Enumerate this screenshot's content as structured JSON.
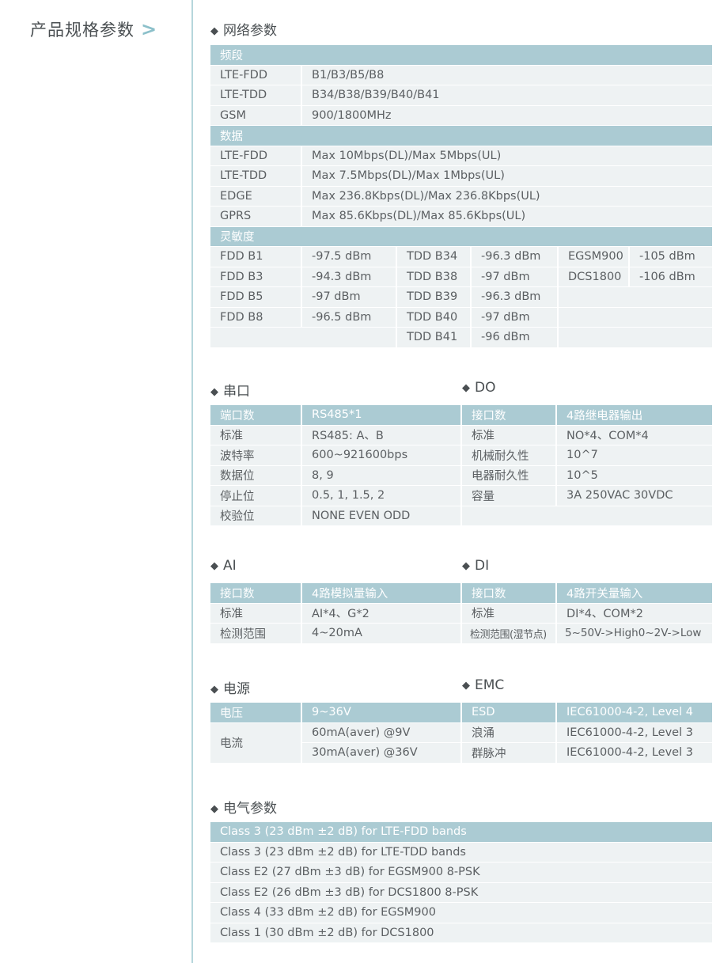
{
  "sidebar": {
    "title": "产品规格参数",
    "chevron": ">"
  },
  "network": {
    "title": "网络参数",
    "band_header": "频段",
    "bands": [
      {
        "name": "LTE-FDD",
        "value": "B1/B3/B5/B8"
      },
      {
        "name": "LTE-TDD",
        "value": "B34/B38/B39/B40/B41"
      },
      {
        "name": "GSM",
        "value": "900/1800MHz"
      }
    ],
    "data_header": "数据",
    "data": [
      {
        "name": "LTE-FDD",
        "value": "Max 10Mbps(DL)/Max 5Mbps(UL)"
      },
      {
        "name": "LTE-TDD",
        "value": "Max 7.5Mbps(DL)/Max 1Mbps(UL)"
      },
      {
        "name": "EDGE",
        "value": "Max 236.8Kbps(DL)/Max 236.8Kbps(UL)"
      },
      {
        "name": "GPRS",
        "value": "Max 85.6Kbps(DL)/Max 85.6Kbps(UL)"
      }
    ],
    "sens_header": "灵敏度",
    "sensitivity": [
      [
        "FDD B1",
        "-97.5 dBm",
        "TDD B34",
        "-96.3 dBm",
        "EGSM900",
        "-105 dBm"
      ],
      [
        "FDD B3",
        "-94.3 dBm",
        "TDD B38",
        "-97 dBm",
        "DCS1800",
        "-106 dBm"
      ],
      [
        "FDD B5",
        "-97 dBm",
        "TDD B39",
        "-96.3 dBm",
        "",
        ""
      ],
      [
        "FDD B8",
        "-96.5 dBm",
        "TDD B40",
        "-97 dBm",
        "",
        ""
      ],
      [
        "",
        "",
        "TDD B41",
        "-96 dBm",
        "",
        ""
      ]
    ]
  },
  "serial": {
    "title": "串口",
    "header": [
      "端口数",
      "RS485*1"
    ],
    "rows": [
      [
        "标准",
        "RS485: A、B"
      ],
      [
        "波特率",
        "600~921600bps"
      ],
      [
        "数据位",
        "8, 9"
      ],
      [
        "停止位",
        "0.5, 1, 1.5, 2"
      ],
      [
        "校验位",
        "NONE EVEN ODD"
      ]
    ]
  },
  "do": {
    "title": "DO",
    "header": [
      "接口数",
      "4路继电器输出"
    ],
    "rows": [
      [
        "标准",
        "NO*4、COM*4"
      ],
      [
        "机械耐久性",
        "10^7"
      ],
      [
        "电器耐久性",
        "10^5"
      ],
      [
        "容量",
        "3A  250VAC 30VDC"
      ]
    ]
  },
  "ai": {
    "title": "AI",
    "header": [
      "接口数",
      "4路模拟量输入"
    ],
    "rows": [
      [
        "标准",
        "AI*4、G*2"
      ],
      [
        "检测范围",
        "4~20mA"
      ]
    ]
  },
  "di": {
    "title": "DI",
    "header": [
      "接口数",
      "4路开关量输入"
    ],
    "rows": [
      [
        "标准",
        "DI*4、COM*2"
      ],
      [
        "检测范围(湿节点)",
        "5~50V->High0~2V->Low"
      ]
    ]
  },
  "power": {
    "title": "电源",
    "header": [
      "电压",
      "9~36V"
    ],
    "current_label": "电流",
    "current_values": [
      "60mA(aver) @9V",
      "30mA(aver) @36V"
    ]
  },
  "emc": {
    "title": "EMC",
    "header": [
      "ESD",
      "IEC61000-4-2, Level 4"
    ],
    "rows": [
      [
        "浪涌",
        "IEC61000-4-2, Level 3"
      ],
      [
        "群脉冲",
        "IEC61000-4-2, Level 3"
      ]
    ]
  },
  "electrical": {
    "title": "电气参数",
    "header": "Class 3 (23 dBm ±2 dB) for LTE-FDD bands",
    "rows": [
      "Class 3 (23 dBm ±2 dB) for LTE-TDD bands",
      "Class E2 (27 dBm ±3 dB) for EGSM900 8-PSK",
      "Class E2 (26 dBm ±3 dB) for DCS1800 8-PSK",
      "Class 4 (33 dBm ±2 dB) for EGSM900",
      "Class 1 (30 dBm ±2 dB) for DCS1800"
    ]
  },
  "colors": {
    "header": "#abcbd3",
    "row": "#eef2f3",
    "rule": "#b6d6dc",
    "text": "#5b5f62"
  }
}
